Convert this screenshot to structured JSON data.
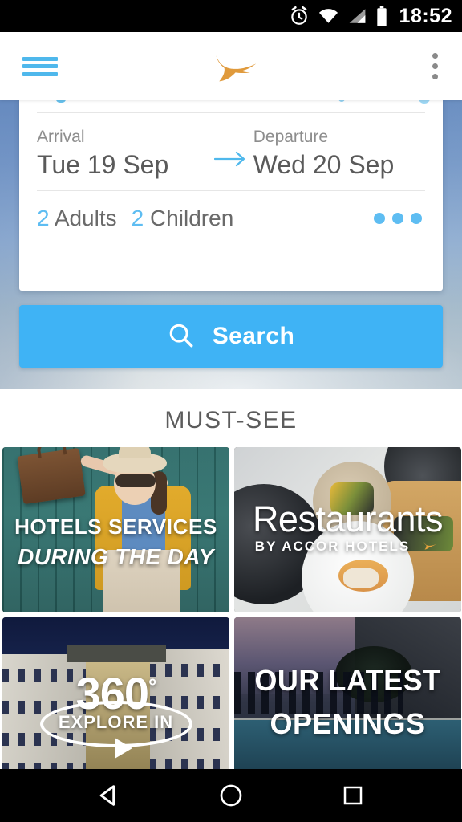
{
  "status_bar": {
    "clock": "18:52",
    "icons": [
      "alarm-icon",
      "wifi-icon",
      "cellular-signal-icon",
      "battery-icon"
    ]
  },
  "app_bar": {
    "menu_icon": "hamburger-menu-icon",
    "logo": "accor-hotels-bird-logo",
    "overflow_icon": "overflow-menu-icon",
    "accent_color": "#4FB8EC",
    "logo_color": "#E09A3C"
  },
  "search_card": {
    "arrival": {
      "label": "Arrival",
      "value": "Tue 19 Sep"
    },
    "arrow_icon": "arrow-right-icon",
    "departure": {
      "label": "Departure",
      "value": "Wed 20 Sep"
    },
    "occupancy": {
      "adults_count": "2",
      "adults_label": "Adults",
      "children_count": "2",
      "children_label": "Children",
      "more_icon": "more-options-dots-icon"
    },
    "accent_color": "#5EBDF2"
  },
  "search_button": {
    "label": "Search",
    "icon": "search-icon",
    "color": "#3FB3F5"
  },
  "must_see": {
    "title": "MUST-SEE",
    "tiles": [
      {
        "line1": "HOTELS SERVICES",
        "line2": "DURING THE DAY",
        "image": "woman-with-suitcase-photo"
      },
      {
        "line1": "Restaurants",
        "line2": "BY ACCOR HOTELS",
        "image": "gourmet-plates-photo"
      },
      {
        "line1": "360",
        "degree": "°",
        "line2": "EXPLORE IN",
        "image": "hotel-courtyard-photo"
      },
      {
        "line1": "OUR LATEST",
        "line2": "OPENINGS",
        "image": "rooftop-pool-photo"
      }
    ]
  },
  "nav_bar": {
    "back_icon": "back-triangle-icon",
    "home_icon": "home-circle-icon",
    "recents_icon": "recents-square-icon"
  }
}
